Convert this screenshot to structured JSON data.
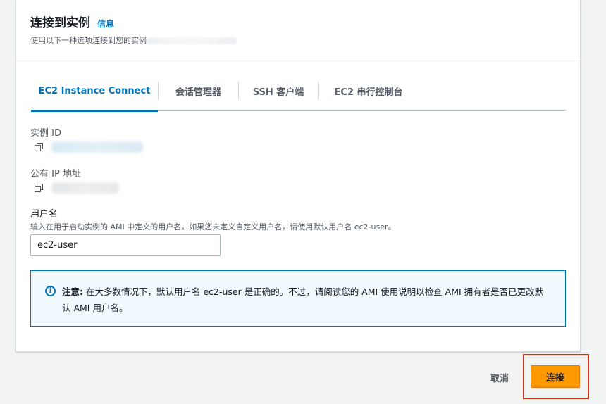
{
  "panel": {
    "title": "连接到实例",
    "info_link": "信息",
    "description": "使用以下一种选项连接到您的实例"
  },
  "tabs": [
    {
      "label": "EC2 Instance Connect",
      "active": true
    },
    {
      "label": "会话管理器",
      "active": false
    },
    {
      "label": "SSH 客户端",
      "active": false
    },
    {
      "label": "EC2 串行控制台",
      "active": false
    }
  ],
  "fields": {
    "instance_id_label": "实例 ID",
    "public_ip_label": "公有 IP 地址",
    "username_label": "用户名",
    "username_hint": "输入在用于启动实例的 AMI 中定义的用户名。如果您未定义自定义用户名，请使用默认用户名 ec2-user。",
    "username_value": "ec2-user"
  },
  "alert": {
    "prefix": "注意:",
    "message": " 在大多数情况下，默认用户名 ec2-user 是正确的。不过，请阅读您的 AMI 使用说明以检查 AMI 拥有者是否已更改默认 AMI 用户名。"
  },
  "footer": {
    "cancel_label": "取消",
    "connect_label": "连接"
  },
  "icons": {
    "copy": "copy-icon",
    "info": "info-circle-icon"
  },
  "colors": {
    "accent": "#0073bb",
    "primary_button": "#ff9900",
    "highlight": "#d13212"
  }
}
